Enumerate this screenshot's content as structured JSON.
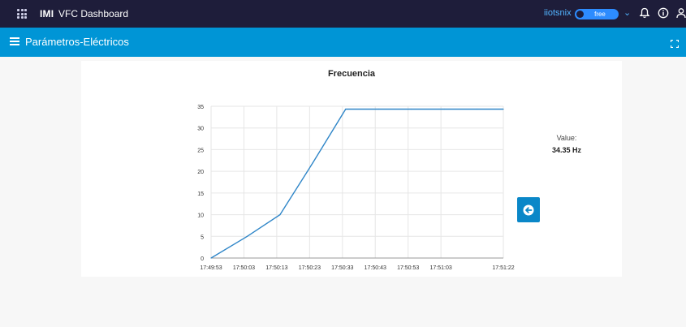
{
  "header": {
    "org": "IMI",
    "app_title": "VFC Dashboard",
    "user": "iiotsnix",
    "plan": "free",
    "icons": [
      "apps-grid-icon",
      "chevron-down-icon",
      "bell-icon",
      "info-icon",
      "user-icon"
    ]
  },
  "subheader": {
    "title": "Parámetros-Eléctricos",
    "icons": [
      "menu-icon",
      "fullscreen-icon"
    ]
  },
  "value_panel": {
    "label": "Value:",
    "value": "34.35 Hz"
  },
  "colors": {
    "topbar": "#1e1d3a",
    "subbar": "#0095d6",
    "line": "#2f86c8",
    "button": "#0a87c8"
  },
  "chart_data": {
    "type": "line",
    "title": "Frecuencia",
    "x_ticks": [
      "17:49:53",
      "17:50:03",
      "17:50:13",
      "17:50:23",
      "17:50:33",
      "17:50:43",
      "17:50:53",
      "17:51:03",
      "17:51:22"
    ],
    "y_ticks": [
      0,
      5,
      10,
      15,
      20,
      25,
      30,
      35
    ],
    "ylim": [
      0,
      35
    ],
    "grid": true,
    "series": [
      {
        "x": [
          "17:49:53",
          "17:50:04",
          "17:50:14",
          "17:50:24",
          "17:50:34",
          "17:50:44",
          "17:50:54",
          "17:51:04",
          "17:51:14",
          "17:51:22"
        ],
        "values": [
          0,
          5,
          10,
          22,
          34.35,
          34.35,
          34.35,
          34.35,
          34.35,
          34.35
        ]
      }
    ]
  }
}
